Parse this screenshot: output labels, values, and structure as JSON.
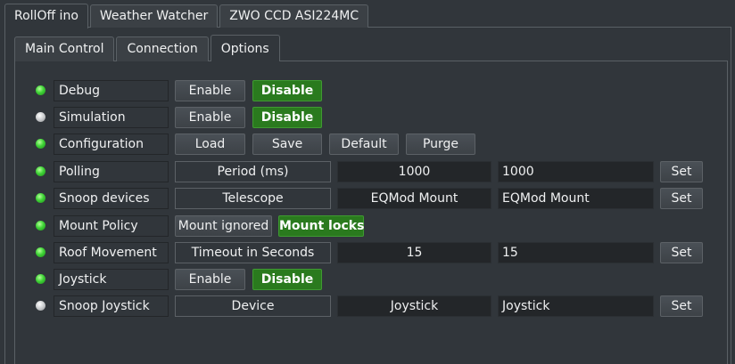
{
  "device_tabs": [
    {
      "label": "RollOff ino",
      "active": true
    },
    {
      "label": "Weather Watcher",
      "active": false
    },
    {
      "label": "ZWO CCD ASI224MC",
      "active": false
    }
  ],
  "group_tabs": [
    {
      "label": "Main Control",
      "active": false
    },
    {
      "label": "Connection",
      "active": false
    },
    {
      "label": "Options",
      "active": true
    }
  ],
  "colors": {
    "background": "#31363b",
    "button_on": "#2a7a1e",
    "led_ok": "#3fd336",
    "led_idle": "#c9cbcd",
    "value_field": "#232629"
  },
  "properties": [
    {
      "label": "Debug",
      "state": "ok",
      "buttons": [
        {
          "label": "Enable",
          "on": false
        },
        {
          "label": "Disable",
          "on": true
        }
      ]
    },
    {
      "label": "Simulation",
      "state": "idle",
      "buttons": [
        {
          "label": "Enable",
          "on": false
        },
        {
          "label": "Disable",
          "on": true
        }
      ]
    },
    {
      "label": "Configuration",
      "state": "ok",
      "buttons": [
        {
          "label": "Load",
          "on": false
        },
        {
          "label": "Save",
          "on": false
        },
        {
          "label": "Default",
          "on": false
        },
        {
          "label": "Purge",
          "on": false
        }
      ]
    },
    {
      "label": "Polling",
      "state": "ok",
      "field_label": "Period (ms)",
      "current": "1000",
      "input": "1000",
      "set_label": "Set"
    },
    {
      "label": "Snoop devices",
      "state": "ok",
      "field_label": "Telescope",
      "current": "EQMod Mount",
      "input": "EQMod Mount",
      "set_label": "Set"
    },
    {
      "label": "Mount Policy",
      "state": "ok",
      "buttons": [
        {
          "label": "Mount ignored",
          "on": false
        },
        {
          "label": "Mount locks",
          "on": true
        }
      ]
    },
    {
      "label": "Roof Movement",
      "state": "ok",
      "field_label": "Timeout in Seconds",
      "current": "15",
      "input": "15",
      "set_label": "Set"
    },
    {
      "label": "Joystick",
      "state": "ok",
      "buttons": [
        {
          "label": "Enable",
          "on": false
        },
        {
          "label": "Disable",
          "on": true
        }
      ]
    },
    {
      "label": "Snoop Joystick",
      "state": "idle",
      "field_label": "Device",
      "current": "Joystick",
      "input": "Joystick",
      "set_label": "Set"
    }
  ]
}
